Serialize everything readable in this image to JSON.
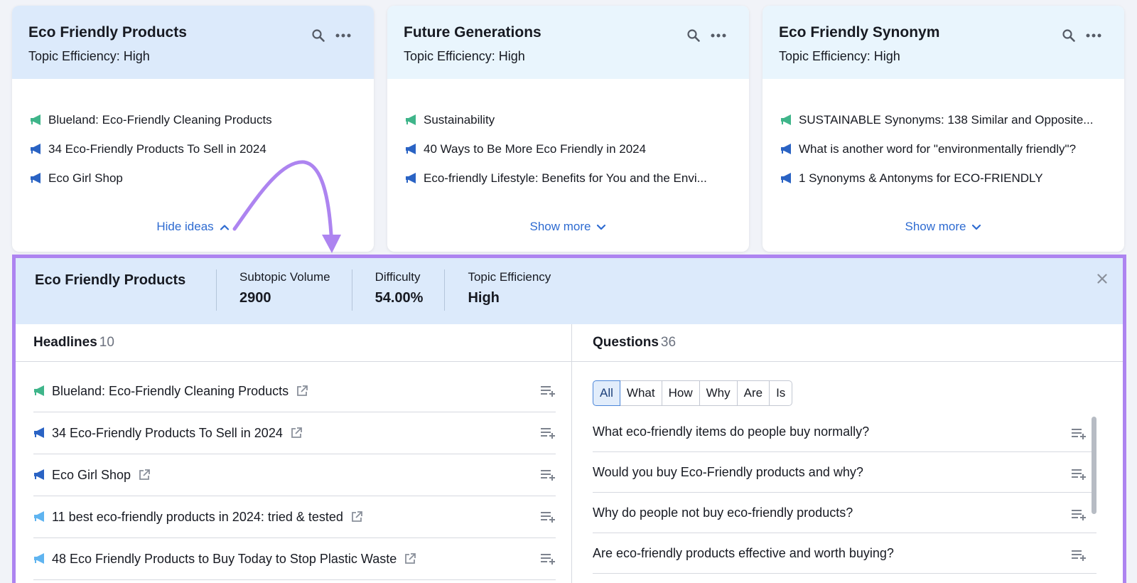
{
  "colors": {
    "accent": "#2e6bd1",
    "highlight": "#ad84f0",
    "header_bg": "#dceafb",
    "mega_green": "#3fb58a",
    "mega_blue": "#2a63c4",
    "mega_light": "#5fb4f0"
  },
  "cards": [
    {
      "title": "Eco Friendly Products",
      "subtitle": "Topic Efficiency: High",
      "items": [
        {
          "text": "Blueland: Eco-Friendly Cleaning Products",
          "icon": "megaphone-green-icon"
        },
        {
          "text": "34 Eco-Friendly Products To Sell in 2024",
          "icon": "megaphone-blue-icon"
        },
        {
          "text": "Eco Girl Shop",
          "icon": "megaphone-blue-icon"
        }
      ],
      "link": "Hide ideas",
      "link_icon": "chevron-up-icon"
    },
    {
      "title": "Future Generations",
      "subtitle": "Topic Efficiency: High",
      "items": [
        {
          "text": "Sustainability",
          "icon": "megaphone-green-icon"
        },
        {
          "text": "40 Ways to Be More Eco Friendly in 2024",
          "icon": "megaphone-blue-icon"
        },
        {
          "text": "Eco-friendly Lifestyle: Benefits for You and the Envi...",
          "icon": "megaphone-blue-icon"
        }
      ],
      "link": "Show more",
      "link_icon": "chevron-down-icon"
    },
    {
      "title": "Eco Friendly Synonym",
      "subtitle": "Topic Efficiency: High",
      "items": [
        {
          "text": "SUSTAINABLE Synonyms: 138 Similar and Opposite...",
          "icon": "megaphone-green-icon"
        },
        {
          "text": "What is another word for \"environmentally friendly\"?",
          "icon": "megaphone-blue-icon"
        },
        {
          "text": "1 Synonyms & Antonyms for ECO-FRIENDLY",
          "icon": "megaphone-blue-icon"
        }
      ],
      "link": "Show more",
      "link_icon": "chevron-down-icon"
    }
  ],
  "panel": {
    "title": "Eco Friendly Products",
    "metrics": [
      {
        "label": "Subtopic Volume",
        "value": "2900"
      },
      {
        "label": "Difficulty",
        "value": "54.00%"
      },
      {
        "label": "Topic Efficiency",
        "value": "High"
      }
    ],
    "headlines": {
      "label": "Headlines",
      "count": "10",
      "items": [
        {
          "text": "Blueland: Eco-Friendly Cleaning Products",
          "icon": "megaphone-green-icon"
        },
        {
          "text": "34 Eco-Friendly Products To Sell in 2024",
          "icon": "megaphone-blue-icon"
        },
        {
          "text": "Eco Girl Shop",
          "icon": "megaphone-blue-icon"
        },
        {
          "text": "11 best eco-friendly products in 2024: tried & tested",
          "icon": "megaphone-light-icon"
        },
        {
          "text": "48 Eco Friendly Products to Buy Today to Stop Plastic Waste",
          "icon": "megaphone-light-icon"
        }
      ]
    },
    "questions": {
      "label": "Questions",
      "count": "36",
      "filters": [
        "All",
        "What",
        "How",
        "Why",
        "Are",
        "Is"
      ],
      "active_filter": "All",
      "items": [
        "What eco-friendly items do people buy normally?",
        "Would you buy Eco-Friendly products and why?",
        "Why do people not buy eco-friendly products?",
        "Are eco-friendly products effective and worth buying?"
      ]
    }
  }
}
